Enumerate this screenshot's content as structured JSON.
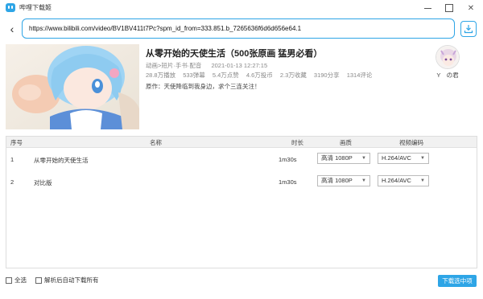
{
  "window": {
    "title": "哔哩下载姬",
    "min_icon": "minimize-icon",
    "max_icon": "maximize-icon",
    "close_label": "✕"
  },
  "urlbar": {
    "back_label": "‹",
    "url_value": "https://www.bilibili.com/video/BV1BV411t7Pc?spm_id_from=333.851.b_7265636f6d6d656e64.1",
    "download_icon": "download-icon"
  },
  "video": {
    "title": "从零开始的天使生活（500张原画 猛男必看）",
    "category": "动画>短片·手书·配音",
    "date": "2021-01-13 12:27:15",
    "stats": [
      "28.8万播放",
      "533弹幕",
      "5.4万点赞",
      "4.6万投币",
      "2.3万收藏",
      "3190分享",
      "1314评论"
    ],
    "description": "原作：天使降临到我身边，求个三连关注！",
    "uploader_name": "Y　の君"
  },
  "table": {
    "headers": {
      "index": "序号",
      "name": "名称",
      "duration": "时长",
      "quality": "画质",
      "codec": "视频编码"
    },
    "rows": [
      {
        "index": "1",
        "name": "从零开始的天使生活",
        "duration": "1m30s",
        "quality": "高清 1080P",
        "codec": "H.264/AVC"
      },
      {
        "index": "2",
        "name": "对比版",
        "duration": "1m30s",
        "quality": "高清 1080P",
        "codec": "H.264/AVC"
      }
    ]
  },
  "footer": {
    "select_all": "全选",
    "auto_download": "解析后自动下载所有",
    "download_selected": "下载选中项"
  },
  "colors": {
    "accent": "#2ea5e6"
  }
}
